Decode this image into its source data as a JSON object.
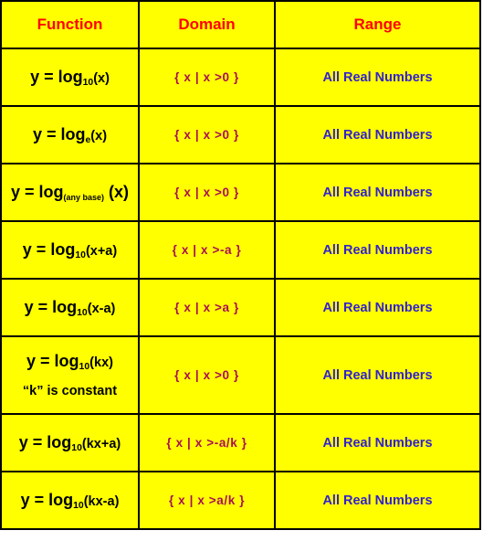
{
  "table": {
    "headers": [
      {
        "label": "Function"
      },
      {
        "label": "Domain"
      },
      {
        "label": "Range"
      }
    ],
    "colors": {
      "background": "#FFFF00",
      "border": "#000000",
      "header_text": "#FF0000",
      "function_text": "#000000",
      "domain_text": "#A81054",
      "range_text": "#3322CC"
    },
    "rows": [
      {
        "function_prefix": "y = log",
        "function_base": "10",
        "function_suffix": "(x)",
        "function_note": "",
        "domain": "{ x  |  x >0 }",
        "range": "All Real Numbers"
      },
      {
        "function_prefix": "y = log",
        "function_base": "e",
        "function_suffix": "(x)",
        "function_note": "",
        "domain": "{ x  |  x >0 }",
        "range": "All Real Numbers"
      },
      {
        "function_prefix": "y = log",
        "function_base": "(any base)",
        "function_suffix": " (x)",
        "function_note": "",
        "domain": "{ x  |  x >0 }",
        "range": "All Real Numbers"
      },
      {
        "function_prefix": "y = log",
        "function_base": "10",
        "function_suffix": "(x+a)",
        "function_note": "",
        "domain": "{ x  |  x >-a }",
        "range": "All Real Numbers"
      },
      {
        "function_prefix": "y = log",
        "function_base": "10",
        "function_suffix": "(x-a)",
        "function_note": "",
        "domain": "{ x  |  x >a }",
        "range": "All Real Numbers"
      },
      {
        "function_prefix": "y = log",
        "function_base": "10",
        "function_suffix": "(kx)",
        "function_note": "“k” is constant",
        "domain": "{ x  |  x >0 }",
        "range": "All Real Numbers"
      },
      {
        "function_prefix": "y = log",
        "function_base": "10",
        "function_suffix": "(kx+a)",
        "function_note": "",
        "domain": "{ x  |  x >-a/k }",
        "range": "All Real Numbers"
      },
      {
        "function_prefix": "y = log",
        "function_base": "10",
        "function_suffix": "(kx-a)",
        "function_note": "",
        "domain": "{ x  |  x >a/k }",
        "range": "All Real Numbers"
      }
    ]
  }
}
